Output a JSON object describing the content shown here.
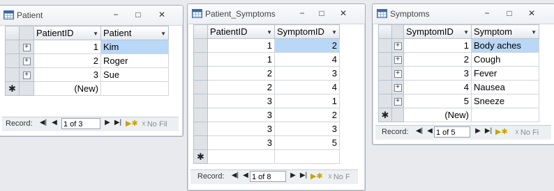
{
  "patient": {
    "title": "Patient",
    "columns": [
      "PatientID",
      "Patient"
    ],
    "rows": [
      {
        "id": "1",
        "name": "Kim"
      },
      {
        "id": "2",
        "name": "Roger"
      },
      {
        "id": "3",
        "name": "Sue"
      }
    ],
    "new_label": "(New)",
    "nav": {
      "record_label": "Record:",
      "position": "1 of 3",
      "filter_label": "No Fil"
    }
  },
  "patient_symptoms": {
    "title": "Patient_Symptoms",
    "columns": [
      "PatientID",
      "SymptomID"
    ],
    "rows": [
      {
        "patient": "1",
        "symptom": "2"
      },
      {
        "patient": "1",
        "symptom": "4"
      },
      {
        "patient": "2",
        "symptom": "3"
      },
      {
        "patient": "2",
        "symptom": "4"
      },
      {
        "patient": "3",
        "symptom": "1"
      },
      {
        "patient": "3",
        "symptom": "2"
      },
      {
        "patient": "3",
        "symptom": "3"
      },
      {
        "patient": "3",
        "symptom": "5"
      }
    ],
    "nav": {
      "record_label": "Record:",
      "position": "1 of 8",
      "filter_label": "No F"
    }
  },
  "symptoms": {
    "title": "Symptoms",
    "columns": [
      "SymptomID",
      "Symptom"
    ],
    "rows": [
      {
        "id": "1",
        "name": "Body aches"
      },
      {
        "id": "2",
        "name": "Cough"
      },
      {
        "id": "3",
        "name": "Fever"
      },
      {
        "id": "4",
        "name": "Nausea"
      },
      {
        "id": "5",
        "name": "Sneeze"
      }
    ],
    "new_label": "(New)",
    "nav": {
      "record_label": "Record:",
      "position": "1 of 5",
      "filter_label": "No Fi"
    }
  },
  "icons": {
    "new_record_marker": "asterisk-icon",
    "expand": "plus-box-icon",
    "nav_first": "first-record-icon",
    "nav_prev": "prev-record-icon",
    "nav_next": "next-record-icon",
    "nav_last": "last-record-icon",
    "nav_new": "new-record-icon",
    "filter": "no-filter-icon"
  },
  "colors": {
    "selected_cell": "#b9d7f6",
    "selector_column": "#dfe3e8",
    "window_border": "#a7acb4"
  }
}
